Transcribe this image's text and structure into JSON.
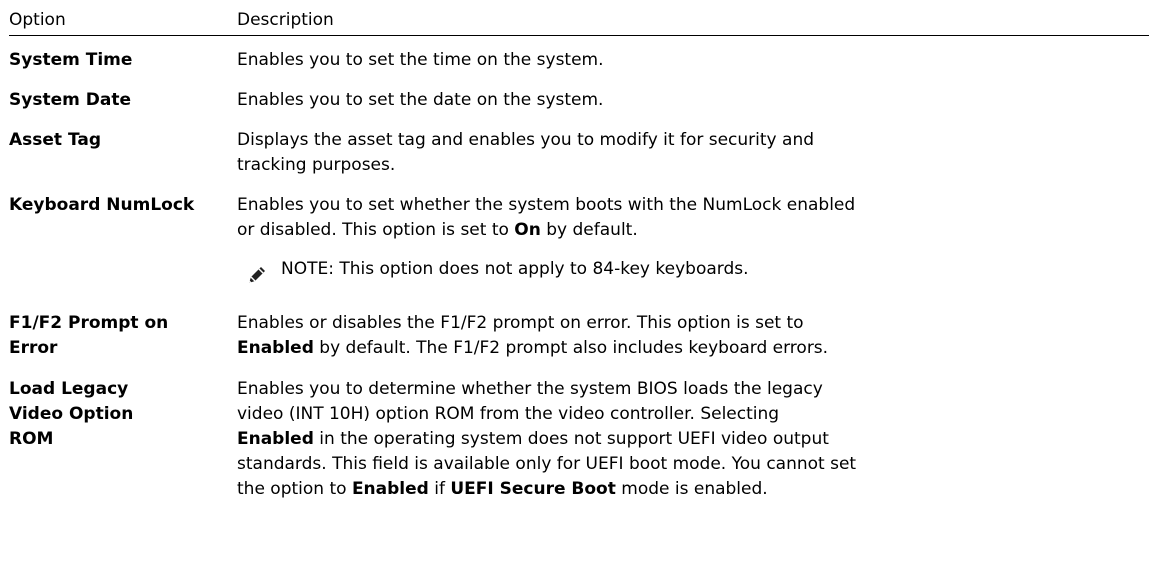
{
  "header": {
    "option": "Option",
    "description": "Description"
  },
  "rows": [
    {
      "option": "System Time",
      "description": "Enables you to set the time on the system."
    },
    {
      "option": "System Date",
      "description": "Enables you to set the date on the system."
    },
    {
      "option": "Asset Tag",
      "description": "Displays the asset tag and enables you to modify it for security and tracking purposes."
    },
    {
      "option": "Keyboard NumLock",
      "desc_part1": "Enables you to set whether the system boots with the NumLock enabled or disabled. This option is set to ",
      "desc_bold1": "On",
      "desc_part2": " by default.",
      "note_label": "NOTE:",
      "note_text": " This option does not apply to 84-key keyboards.",
      "note_icon": "pencil-note-icon"
    },
    {
      "option": "F1/F2 Prompt on Error",
      "desc_part1": "Enables or disables the F1/F2 prompt on error. This option is set to ",
      "desc_bold1": "Enabled",
      "desc_part2": " by default. The F1/F2 prompt also includes keyboard errors."
    },
    {
      "option": "Load Legacy Video Option ROM",
      "desc_part1": "Enables you to determine whether the system BIOS loads the legacy video (INT 10H) option ROM from the video controller. Selecting ",
      "desc_bold1": "Enabled",
      "desc_part2": " in the operating system does not support UEFI video output standards. This field is available only for UEFI boot mode. You cannot set the option to ",
      "desc_bold2": "Enabled",
      "desc_part3": " if ",
      "desc_bold3": "UEFI Secure Boot",
      "desc_part4": " mode is enabled."
    }
  ]
}
